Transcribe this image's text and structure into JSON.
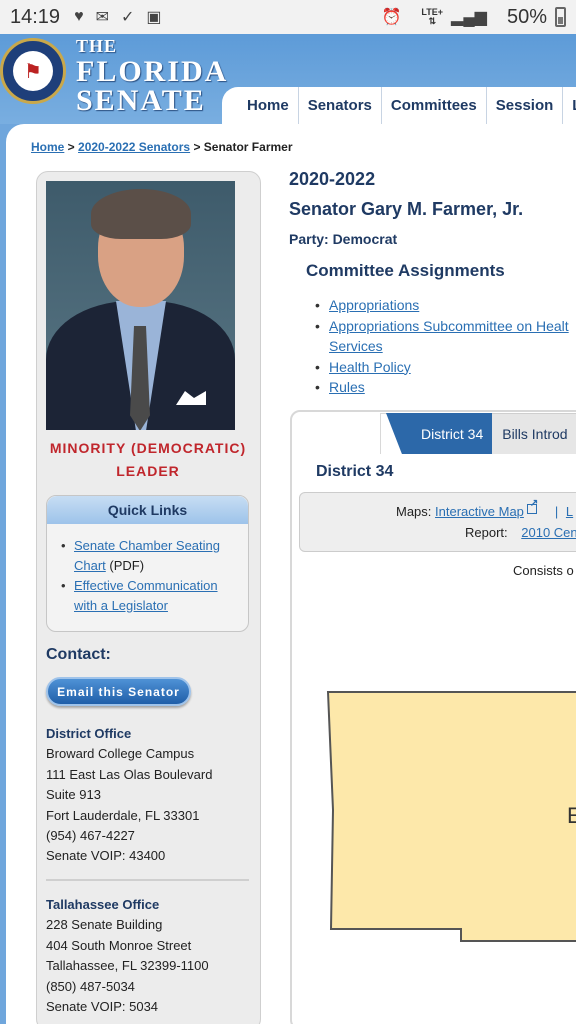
{
  "status_bar": {
    "time": "14:19",
    "left_icons": [
      "iheart-icon",
      "mail-icon",
      "check-icon",
      "image-icon"
    ],
    "network": "LTE+",
    "battery": "50%"
  },
  "header": {
    "brand_the": "THE",
    "brand_line1": "FLORIDA",
    "brand_line2": "SENATE",
    "seal_text": "SENATE · STATE OF FLORIDA",
    "nav": [
      "Home",
      "Senators",
      "Committees",
      "Session",
      "L"
    ]
  },
  "breadcrumb": {
    "home": "Home",
    "sep1": " > ",
    "senators": "2020-2022 Senators",
    "sep2": " > ",
    "current": "Senator Farmer"
  },
  "profile": {
    "title_line1": "MINORITY (DEMOCRATIC)",
    "title_line2": "LEADER"
  },
  "quick_links": {
    "title": "Quick Links",
    "link1_a": "Senate Chamber Seating",
    "link1_b": "Chart",
    "link1_suffix": " (PDF)",
    "link2_a": "Effective Communication",
    "link2_b": "with a Legislator"
  },
  "contact": {
    "title": "Contact:",
    "email_button": "Email this Senator",
    "district_office": {
      "title": "District Office",
      "line1": "Broward College Campus",
      "line2": "111 East Las Olas Boulevard",
      "line3": "Suite 913",
      "line4": "Fort Lauderdale, FL 33301",
      "phone": "(954) 467-4227",
      "voip": "Senate VOIP: 43400"
    },
    "tallahassee_office": {
      "title": "Tallahassee Office",
      "line1": "228 Senate Building",
      "line2": "404 South Monroe Street",
      "line3": "Tallahassee, FL 32399-1100",
      "phone": "(850) 487-5034",
      "voip": "Senate VOIP: 5034"
    }
  },
  "senator": {
    "term": "2020-2022",
    "name": "Senator Gary M. Farmer, Jr.",
    "party_label": "Party: Democrat"
  },
  "committees": {
    "title": "Committee Assignments",
    "items": [
      "Appropriations",
      "Appropriations Subcommittee on Healt",
      "Services",
      "Health Policy",
      "Rules"
    ]
  },
  "district": {
    "tabs": [
      "District 34",
      "Bills Introd"
    ],
    "heading": "District 34",
    "maps_label": "Maps:",
    "maps_link": "Interactive Map",
    "maps_more": "L",
    "report_label": "Report:",
    "report_link": "2010 Cen",
    "consists_text": "Consists o",
    "map_label_partial": "E",
    "map_color": "#fde8aa"
  },
  "colors": {
    "header_blue": "#5d9bd8",
    "navy_text": "#1f3a63",
    "link_blue": "#2a6fb3",
    "leader_red": "#c0262c",
    "tab_active": "#2c68a9"
  }
}
